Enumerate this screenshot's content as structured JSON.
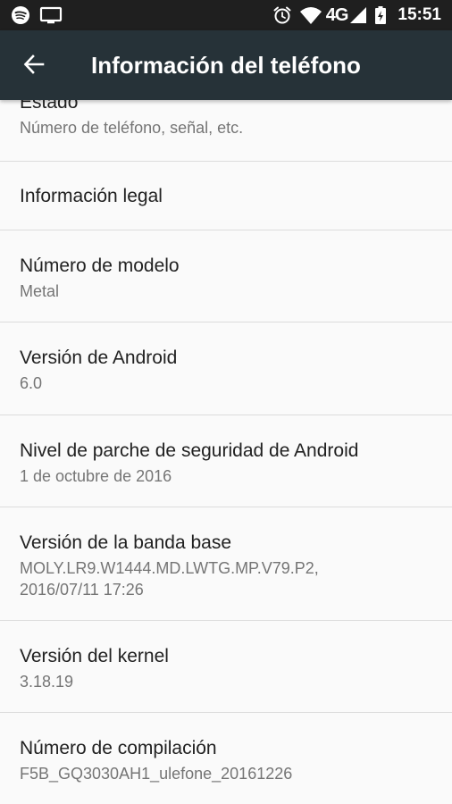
{
  "status_bar": {
    "left_icons": [
      "spotify-icon",
      "cast-screen-icon"
    ],
    "alarm_icon": "alarm-clock-icon",
    "wifi_icon": "wifi-icon",
    "network": "4G",
    "signal_icon": "cell-signal-icon",
    "battery_icon": "battery-charging-icon",
    "time": "15:51"
  },
  "toolbar": {
    "back_icon": "arrow-back-icon",
    "title": "Información del teléfono",
    "background": "#263238"
  },
  "items": [
    {
      "title": "Estado",
      "subtitle": "Número de teléfono, señal, etc."
    },
    {
      "title": "Información legal"
    },
    {
      "title": "Número de modelo",
      "subtitle": "Metal"
    },
    {
      "title": "Versión de Android",
      "subtitle": "6.0"
    },
    {
      "title": "Nivel de parche de seguridad de Android",
      "subtitle": "1 de octubre de 2016"
    },
    {
      "title": "Versión de la banda base",
      "subtitle": "MOLY.LR9.W1444.MD.LWTG.MP.V79.P2,",
      "subtitle_2": "2016/07/11 17:26"
    },
    {
      "title": "Versión del kernel",
      "subtitle": "3.18.19"
    },
    {
      "title": "Número de compilación",
      "subtitle": "F5B_GQ3030AH1_ulefone_20161226"
    }
  ]
}
